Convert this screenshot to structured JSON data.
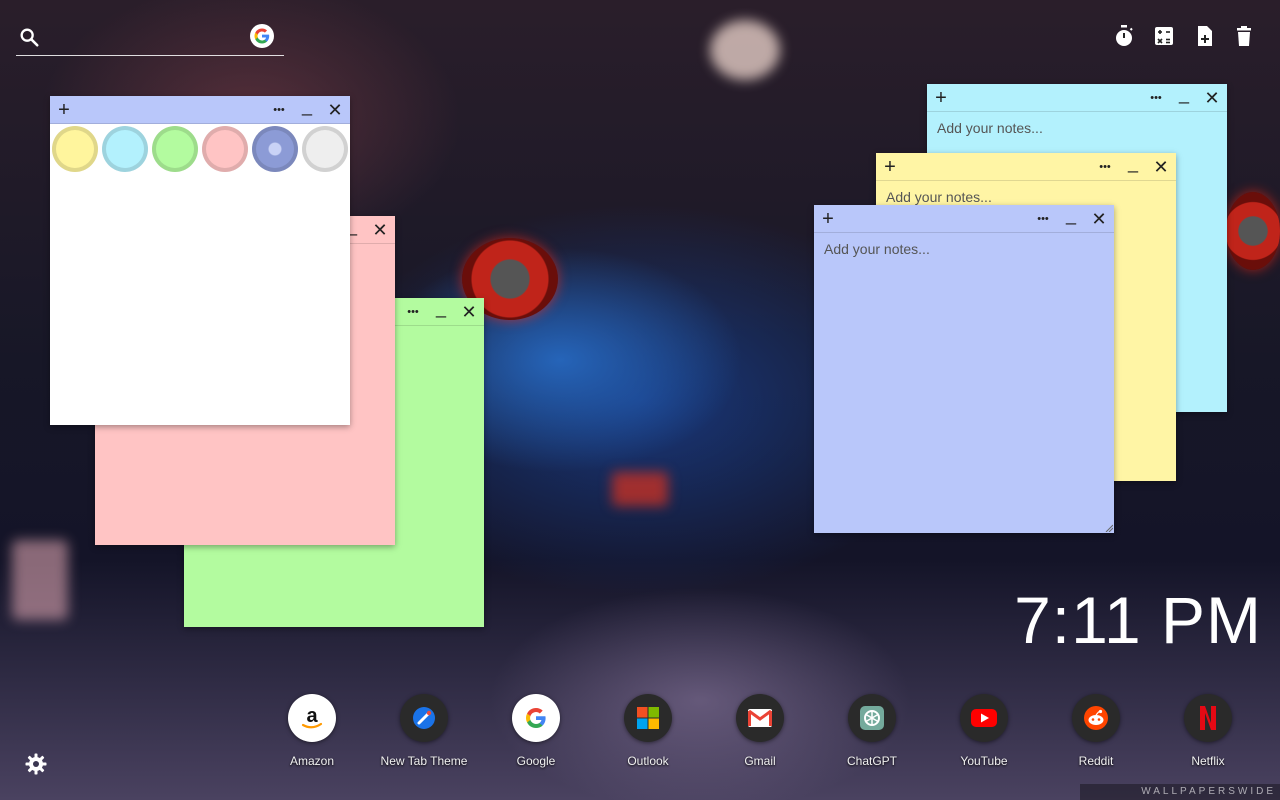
{
  "search": {
    "placeholder": ""
  },
  "toolbar": {
    "timer_icon": "stopwatch-icon",
    "calculator_icon": "calculator-icon",
    "new_note_icon": "note-add-icon",
    "delete_icon": "trash-icon"
  },
  "notes": {
    "white": {
      "color": "#ffffff",
      "text": ""
    },
    "pink": {
      "color": "#ffc4c4",
      "text": ""
    },
    "green": {
      "color": "#b3fb9f",
      "text": ""
    },
    "cyan": {
      "color": "#b3f1fd",
      "placeholder": "Add your notes..."
    },
    "yellow": {
      "color": "#fff5a5",
      "placeholder": "Add your notes..."
    },
    "blue": {
      "color": "#b9c7fa",
      "placeholder": "Add your notes..."
    }
  },
  "note_buttons": {
    "add": "+",
    "more": "•••",
    "minimize": "_",
    "close": "✕"
  },
  "swatches": [
    "#fff59d",
    "#b3f1fd",
    "#b3fb9f",
    "#ffc4c4",
    "#8c9bd6",
    "#eeeeee"
  ],
  "clock": {
    "time": "7:11 PM"
  },
  "dock": [
    {
      "label": "Amazon",
      "icon": "amazon-icon"
    },
    {
      "label": "New Tab Theme",
      "icon": "new-tab-theme-icon"
    },
    {
      "label": "Google",
      "icon": "google-icon"
    },
    {
      "label": "Outlook",
      "icon": "microsoft-icon"
    },
    {
      "label": "Gmail",
      "icon": "gmail-icon"
    },
    {
      "label": "ChatGPT",
      "icon": "chatgpt-icon"
    },
    {
      "label": "YouTube",
      "icon": "youtube-icon"
    },
    {
      "label": "Reddit",
      "icon": "reddit-icon"
    },
    {
      "label": "Netflix",
      "icon": "netflix-icon"
    }
  ],
  "watermark": "WALLPAPERSWIDE"
}
